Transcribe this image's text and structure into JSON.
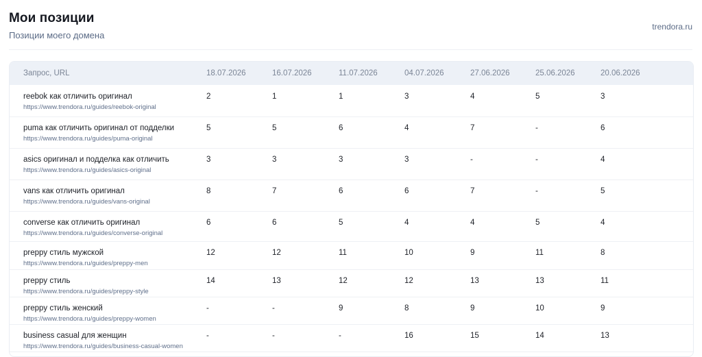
{
  "header": {
    "title": "Мои позиции",
    "subtitle": "Позиции моего домена",
    "domain": "trendora.ru"
  },
  "table": {
    "columns": [
      "Запрос, URL",
      "18.07.2026",
      "16.07.2026",
      "11.07.2026",
      "04.07.2026",
      "27.06.2026",
      "25.06.2026",
      "20.06.2026"
    ],
    "rows": [
      {
        "query": "reebok как отличить оригинал",
        "url": "https://www.trendora.ru/guides/reebok-original",
        "positions": [
          "2",
          "1",
          "1",
          "3",
          "4",
          "5",
          "3"
        ]
      },
      {
        "query": "puma как отличить оригинал от подделки",
        "url": "https://www.trendora.ru/guides/puma-original",
        "positions": [
          "5",
          "5",
          "6",
          "4",
          "7",
          "-",
          "6"
        ]
      },
      {
        "query": "asics оригинал и подделка как отличить",
        "url": "https://www.trendora.ru/guides/asics-original",
        "positions": [
          "3",
          "3",
          "3",
          "3",
          "-",
          "-",
          "4"
        ]
      },
      {
        "query": "vans как отличить оригинал",
        "url": "https://www.trendora.ru/guides/vans-original",
        "positions": [
          "8",
          "7",
          "6",
          "6",
          "7",
          "-",
          "5"
        ]
      },
      {
        "query": "converse как отличить оригинал",
        "url": "https://www.trendora.ru/guides/converse-original",
        "positions": [
          "6",
          "6",
          "5",
          "4",
          "4",
          "5",
          "4"
        ]
      },
      {
        "query": "preppy стиль мужской",
        "url": "https://www.trendora.ru/guides/preppy-men",
        "positions": [
          "12",
          "12",
          "11",
          "10",
          "9",
          "11",
          "8"
        ]
      },
      {
        "query": "preppy стиль",
        "url": "https://www.trendora.ru/guides/preppy-style",
        "positions": [
          "14",
          "13",
          "12",
          "12",
          "13",
          "13",
          "11"
        ]
      },
      {
        "query": "preppy стиль женский",
        "url": "https://www.trendora.ru/guides/preppy-women",
        "positions": [
          "-",
          "-",
          "9",
          "8",
          "9",
          "10",
          "9"
        ]
      },
      {
        "query": "business casual для женщин",
        "url": "https://www.trendora.ru/guides/business-casual-women",
        "positions": [
          "-",
          "-",
          "-",
          "16",
          "15",
          "14",
          "13"
        ]
      }
    ]
  }
}
